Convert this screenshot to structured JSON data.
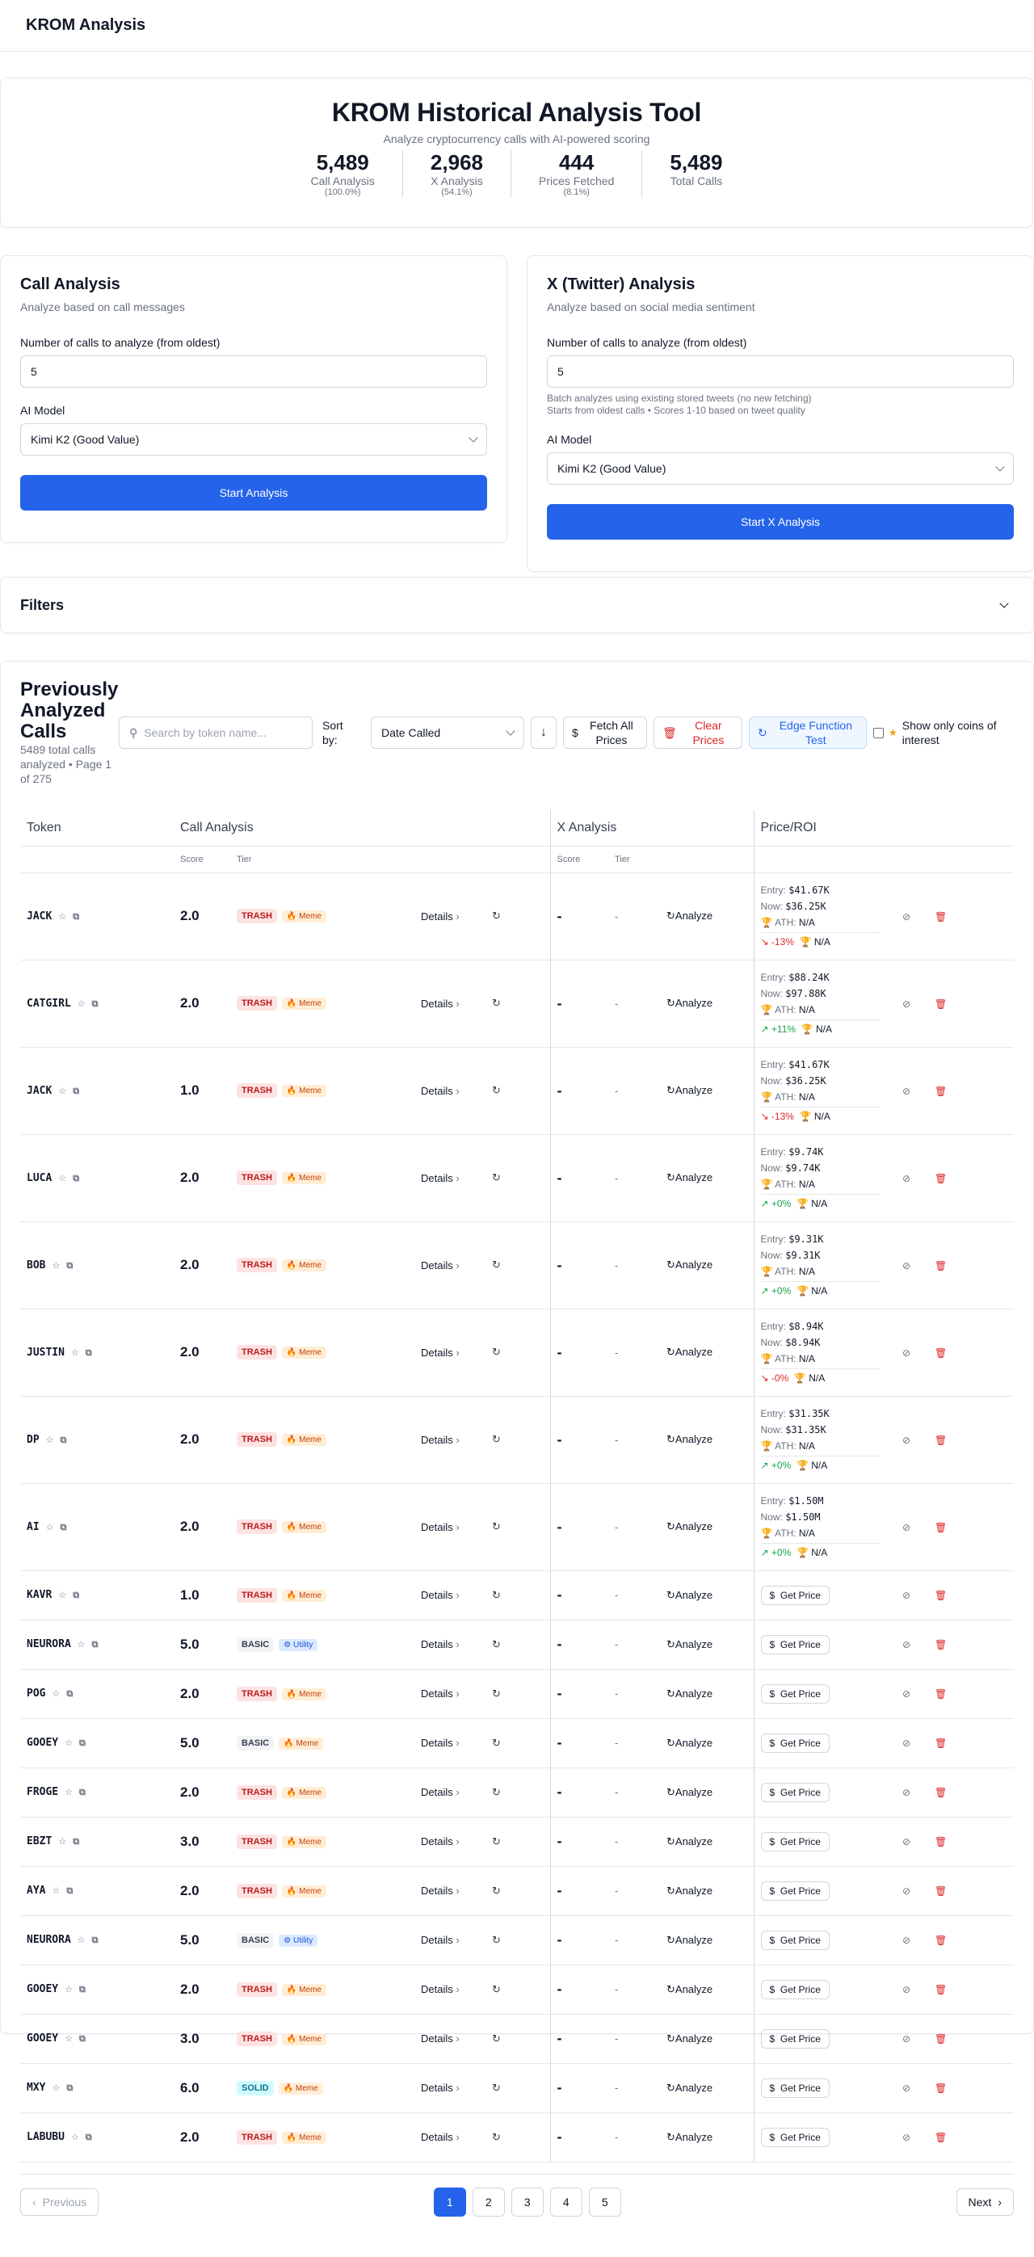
{
  "app": {
    "title": "KROM Analysis"
  },
  "hero": {
    "title": "KROM Historical Analysis Tool",
    "subtitle": "Analyze cryptocurrency calls with AI-powered scoring",
    "stats": [
      {
        "num": "5,489",
        "label": "Call Analysis",
        "pct": "(100.0%)"
      },
      {
        "num": "2,968",
        "label": "X Analysis",
        "pct": "(54.1%)"
      },
      {
        "num": "444",
        "label": "Prices Fetched",
        "pct": "(8.1%)"
      },
      {
        "num": "5,489",
        "label": "Total Calls",
        "pct": ""
      }
    ]
  },
  "call_panel": {
    "title": "Call Analysis",
    "desc": "Analyze based on call messages",
    "count_label": "Number of calls to analyze (from oldest)",
    "count_value": "5",
    "model_label": "AI Model",
    "model_value": "Kimi K2 (Good Value)",
    "button": "Start Analysis"
  },
  "x_panel": {
    "title": "X (Twitter) Analysis",
    "desc": "Analyze based on social media sentiment",
    "count_label": "Number of calls to analyze (from oldest)",
    "count_value": "5",
    "hint1": "Batch analyzes using existing stored tweets (no new fetching)",
    "hint2": "Starts from oldest calls • Scores 1-10 based on tweet quality",
    "model_label": "AI Model",
    "model_value": "Kimi K2 (Good Value)",
    "button": "Start X Analysis"
  },
  "filters": {
    "label": "Filters"
  },
  "list": {
    "title": "Previously Analyzed Calls",
    "subtitle": "5489 total calls analyzed • Page 1 of 275",
    "search_placeholder": "Search by token name...",
    "sort_label": "Sort by:",
    "sort_value": "Date Called",
    "fetch_label": "Fetch All Prices",
    "clear_label": "Clear Prices",
    "edge_label": "Edge Function Test",
    "interest_label": "Show only coins of interest",
    "headers": {
      "token": "Token",
      "call": "Call Analysis",
      "x": "X Analysis",
      "price": "Price/ROI"
    },
    "sub_headers": {
      "score": "Score",
      "tier": "Tier",
      "xscore": "Score",
      "xtier": "Tier"
    },
    "details_label": "Details",
    "analyze_label": "Analyze",
    "get_price_label": "Get Price",
    "entry_label": "Entry:",
    "now_label": "Now:",
    "ath_label": "ATH:",
    "rows": [
      {
        "token": "JACK",
        "score": "2.0",
        "tier": "TRASH",
        "cat": "Meme",
        "xscore": "-",
        "xtier": "-",
        "entry": "$41.67K",
        "now": "$36.25K",
        "ath": "N/A",
        "roi": "-13%",
        "roi_dir": "neg",
        "ath_roi": "N/A"
      },
      {
        "token": "CATGIRL",
        "score": "2.0",
        "tier": "TRASH",
        "cat": "Meme",
        "xscore": "-",
        "xtier": "-",
        "entry": "$88.24K",
        "now": "$97.88K",
        "ath": "N/A",
        "roi": "+11%",
        "roi_dir": "pos",
        "ath_roi": "N/A"
      },
      {
        "token": "JACK",
        "score": "1.0",
        "tier": "TRASH",
        "cat": "Meme",
        "xscore": "-",
        "xtier": "-",
        "entry": "$41.67K",
        "now": "$36.25K",
        "ath": "N/A",
        "roi": "-13%",
        "roi_dir": "neg",
        "ath_roi": "N/A"
      },
      {
        "token": "LUCA",
        "score": "2.0",
        "tier": "TRASH",
        "cat": "Meme",
        "xscore": "-",
        "xtier": "-",
        "entry": "$9.74K",
        "now": "$9.74K",
        "ath": "N/A",
        "roi": "+0%",
        "roi_dir": "pos",
        "ath_roi": "N/A"
      },
      {
        "token": "BOB",
        "score": "2.0",
        "tier": "TRASH",
        "cat": "Meme",
        "xscore": "-",
        "xtier": "-",
        "entry": "$9.31K",
        "now": "$9.31K",
        "ath": "N/A",
        "roi": "+0%",
        "roi_dir": "pos",
        "ath_roi": "N/A"
      },
      {
        "token": "JUSTIN",
        "score": "2.0",
        "tier": "TRASH",
        "cat": "Meme",
        "xscore": "-",
        "xtier": "-",
        "entry": "$8.94K",
        "now": "$8.94K",
        "ath": "N/A",
        "roi": "-0%",
        "roi_dir": "neg",
        "ath_roi": "N/A"
      },
      {
        "token": "DP",
        "score": "2.0",
        "tier": "TRASH",
        "cat": "Meme",
        "xscore": "-",
        "xtier": "-",
        "entry": "$31.35K",
        "now": "$31.35K",
        "ath": "N/A",
        "roi": "+0%",
        "roi_dir": "pos",
        "ath_roi": "N/A"
      },
      {
        "token": "AI",
        "score": "2.0",
        "tier": "TRASH",
        "cat": "Meme",
        "xscore": "-",
        "xtier": "-",
        "entry": "$1.50M",
        "now": "$1.50M",
        "ath": "N/A",
        "roi": "+0%",
        "roi_dir": "pos",
        "ath_roi": "N/A"
      },
      {
        "token": "KAVR",
        "score": "1.0",
        "tier": "TRASH",
        "cat": "Meme",
        "xscore": "-",
        "xtier": "-"
      },
      {
        "token": "NEURORA",
        "score": "5.0",
        "tier": "BASIC",
        "cat": "Utility",
        "xscore": "-",
        "xtier": "-"
      },
      {
        "token": "POG",
        "score": "2.0",
        "tier": "TRASH",
        "cat": "Meme",
        "xscore": "-",
        "xtier": "-"
      },
      {
        "token": "GOOEY",
        "score": "5.0",
        "tier": "BASIC",
        "cat": "Meme",
        "xscore": "-",
        "xtier": "-"
      },
      {
        "token": "FROGE",
        "score": "2.0",
        "tier": "TRASH",
        "cat": "Meme",
        "xscore": "-",
        "xtier": "-"
      },
      {
        "token": "EBZT",
        "score": "3.0",
        "tier": "TRASH",
        "cat": "Meme",
        "xscore": "-",
        "xtier": "-"
      },
      {
        "token": "AYA",
        "score": "2.0",
        "tier": "TRASH",
        "cat": "Meme",
        "xscore": "-",
        "xtier": "-"
      },
      {
        "token": "NEURORA",
        "score": "5.0",
        "tier": "BASIC",
        "cat": "Utility",
        "xscore": "-",
        "xtier": "-"
      },
      {
        "token": "GOOEY",
        "score": "2.0",
        "tier": "TRASH",
        "cat": "Meme",
        "xscore": "-",
        "xtier": "-"
      },
      {
        "token": "GOOEY",
        "score": "3.0",
        "tier": "TRASH",
        "cat": "Meme",
        "xscore": "-",
        "xtier": "-"
      },
      {
        "token": "MXY",
        "score": "6.0",
        "tier": "SOLID",
        "cat": "Meme",
        "xscore": "-",
        "xtier": "-"
      },
      {
        "token": "LABUBU",
        "score": "2.0",
        "tier": "TRASH",
        "cat": "Meme",
        "xscore": "-",
        "xtier": "-"
      }
    ]
  },
  "pagination": {
    "prev": "Previous",
    "next": "Next",
    "pages": [
      "1",
      "2",
      "3",
      "4",
      "5"
    ],
    "current": "1"
  },
  "colors": {
    "primary": "#2563eb",
    "danger": "#dc2626",
    "positive": "#16a34a"
  }
}
